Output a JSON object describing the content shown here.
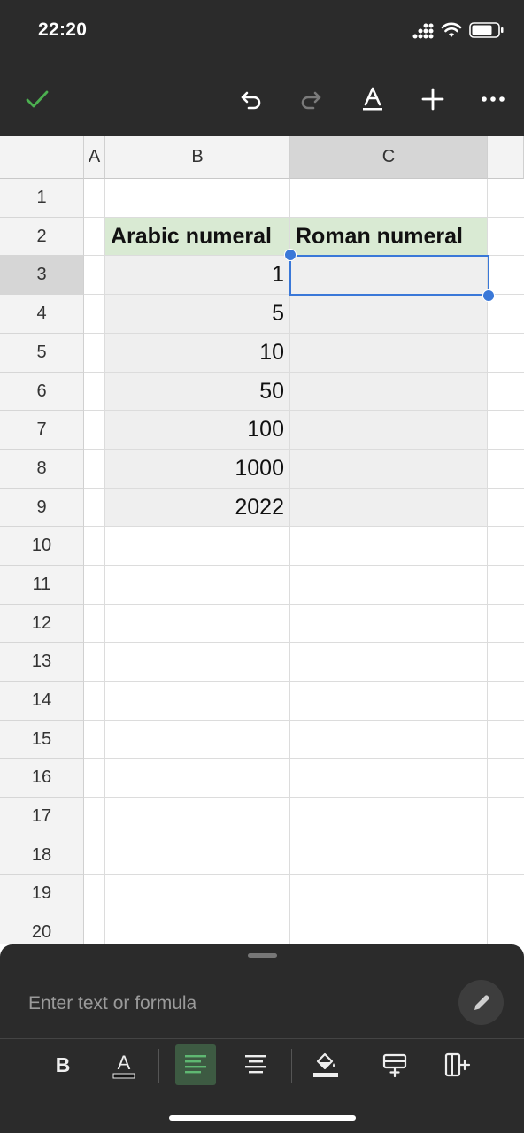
{
  "status_bar": {
    "time": "22:20"
  },
  "toolbar": {
    "icons": [
      "check-icon",
      "undo-icon",
      "redo-icon",
      "text-format-icon",
      "insert-icon",
      "more-icon"
    ],
    "accent_color": "#4caf50"
  },
  "grid": {
    "columns": [
      "A",
      "B",
      "C"
    ],
    "rows": [
      "1",
      "2",
      "3",
      "4",
      "5",
      "6",
      "7",
      "8",
      "9",
      "10",
      "11",
      "12",
      "13",
      "14",
      "15",
      "16",
      "17",
      "18",
      "19",
      "20"
    ],
    "selected_cell": "C3",
    "header_row": {
      "b": "Arabic numeral",
      "c": "Roman numeral"
    },
    "values": [
      "1",
      "5",
      "10",
      "50",
      "100",
      "1000",
      "2022"
    ],
    "header_fill": "#d9ead3",
    "selection_color": "#3a78d8"
  },
  "formula_bar": {
    "placeholder": "Enter text or formula"
  },
  "format_bar": {
    "icons": [
      "bold-icon",
      "text-color-icon",
      "align-left-icon",
      "align-center-icon",
      "fill-color-icon",
      "insert-row-icon",
      "insert-column-icon"
    ],
    "bold_label": "B",
    "text_color_label": "A"
  }
}
